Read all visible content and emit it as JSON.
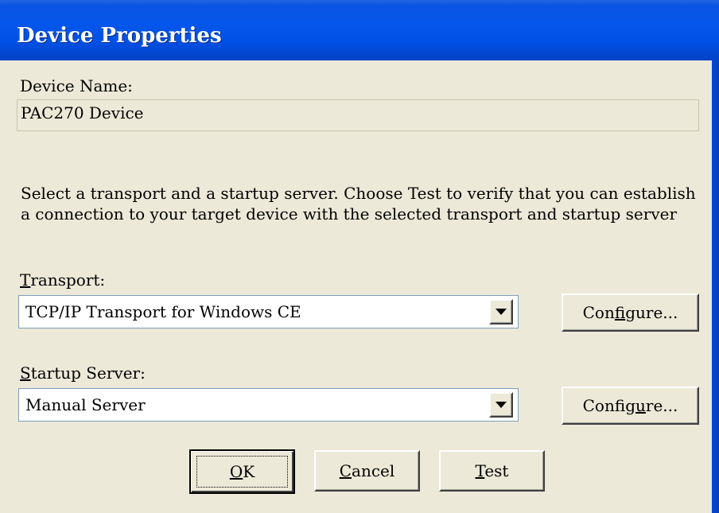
{
  "window": {
    "title": "Device Properties"
  },
  "device_name": {
    "label": "Device Name:",
    "value": "PAC270 Device"
  },
  "description": "Select a transport and a startup server. Choose Test to verify that you can establish a connection to your target device with the selected transport and startup server",
  "transport": {
    "label_mnemonic": "T",
    "label_rest": "ransport:",
    "selected": "TCP/IP Transport for Windows CE",
    "configure_pre": "Con",
    "configure_mnemonic": "f",
    "configure_post": "igure..."
  },
  "startup_server": {
    "label_mnemonic": "S",
    "label_rest": "tartup Server:",
    "selected": "Manual Server",
    "configure_pre": "Config",
    "configure_mnemonic": "u",
    "configure_post": "re..."
  },
  "buttons": {
    "ok_mnemonic": "O",
    "ok_rest": "K",
    "cancel_mnemonic": "C",
    "cancel_rest": "ancel",
    "test_mnemonic": "T",
    "test_rest": "est"
  },
  "colors": {
    "dialog_bg": "#ECE9D8",
    "titlebar": "#0556EA",
    "title_text": "#FFFFFF"
  },
  "icons": {
    "dropdown": "chevron-down-icon"
  }
}
